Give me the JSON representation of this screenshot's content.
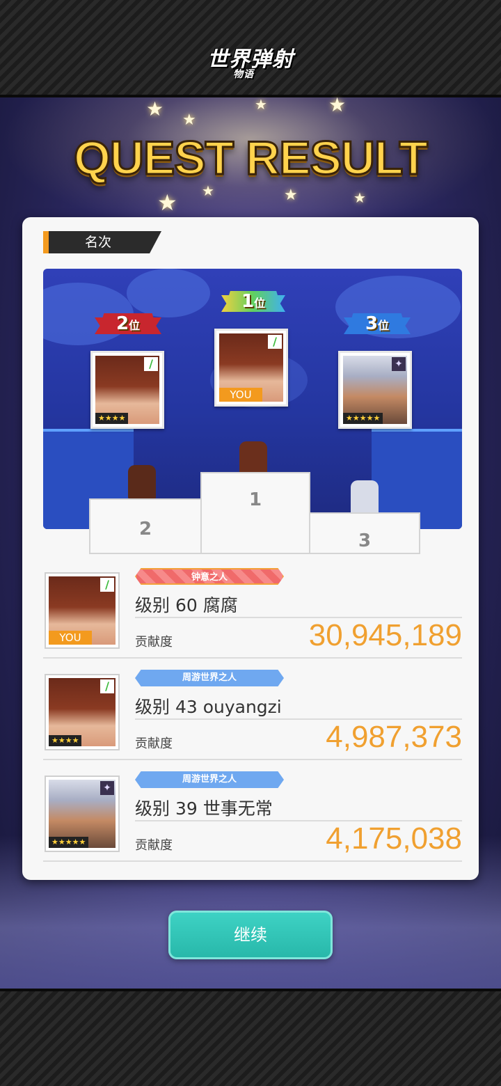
{
  "logo": {
    "main": "世界弹射",
    "sub": "物语"
  },
  "title": "QUEST RESULT",
  "section_label": "名次",
  "podium": {
    "first": {
      "rank": "1",
      "suffix": "位",
      "block_number": "1",
      "you": "YOU"
    },
    "second": {
      "rank": "2",
      "suffix": "位",
      "block_number": "2",
      "rarity": "★★★★"
    },
    "third": {
      "rank": "3",
      "suffix": "位",
      "block_number": "3",
      "rarity": "★★★★★"
    }
  },
  "results": [
    {
      "badge": "钟意之人",
      "badge_style": "orange",
      "name": "级别 60 腐腐",
      "label": "贡献度",
      "score": "30,945,189",
      "tag": "YOU",
      "element": "leaf"
    },
    {
      "badge": "周游世界之人",
      "badge_style": "blue",
      "name": "级别 43 ouyangzi",
      "label": "贡献度",
      "score": "4,987,373",
      "tag": "★★★★",
      "element": "leaf"
    },
    {
      "badge": "周游世界之人",
      "badge_style": "blue",
      "name": "级别 39 世事无常",
      "label": "贡献度",
      "score": "4,175,038",
      "tag": "★★★★★",
      "element": "dark"
    }
  ],
  "continue_label": "继续",
  "colors": {
    "accent": "#f39a1e",
    "score": "#f0a030",
    "button": "#3ed2c4"
  }
}
